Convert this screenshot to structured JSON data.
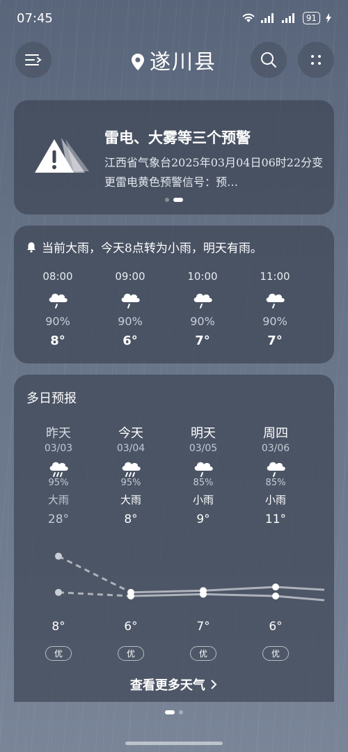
{
  "status_bar": {
    "time": "07:45",
    "battery": "91"
  },
  "header": {
    "city": "遂川县"
  },
  "alert": {
    "title": "雷电、大雾等三个预警",
    "text": "江西省气象台2025年03月04日06时22分变更雷电黄色预警信号：预…"
  },
  "hourly": {
    "summary": "当前大雨，今天8点转为小雨，明天有雨。",
    "items": [
      {
        "time": "08:00",
        "precip": "90%",
        "temp": "8°",
        "icon": "rain-cloud-icon"
      },
      {
        "time": "09:00",
        "precip": "90%",
        "temp": "6°",
        "icon": "rain-cloud-icon"
      },
      {
        "time": "10:00",
        "precip": "90%",
        "temp": "7°",
        "icon": "rain-cloud-icon"
      },
      {
        "time": "11:00",
        "precip": "90%",
        "temp": "7°",
        "icon": "rain-cloud-icon"
      }
    ]
  },
  "daily": {
    "title": "多日预报",
    "days": [
      {
        "name": "昨天",
        "date": "03/03",
        "precip": "95%",
        "weather": "大雨",
        "high": "28°",
        "low": "8°",
        "aqi": "优",
        "icon": "heavy-rain-icon"
      },
      {
        "name": "今天",
        "date": "03/04",
        "precip": "95%",
        "weather": "大雨",
        "high": "8°",
        "low": "6°",
        "aqi": "优",
        "icon": "heavy-rain-icon"
      },
      {
        "name": "明天",
        "date": "03/05",
        "precip": "85%",
        "weather": "小雨",
        "high": "9°",
        "low": "7°",
        "aqi": "优",
        "icon": "light-rain-icon"
      },
      {
        "name": "周四",
        "date": "03/06",
        "precip": "85%",
        "weather": "小雨",
        "high": "11°",
        "low": "6°",
        "aqi": "优",
        "icon": "light-rain-icon"
      }
    ],
    "more_label": "查看更多天气"
  },
  "chart_data": {
    "type": "line",
    "categories": [
      "03/03",
      "03/04",
      "03/05",
      "03/06"
    ],
    "series": [
      {
        "values": [
          28,
          8,
          9,
          11
        ]
      },
      {
        "values": [
          8,
          6,
          7,
          6
        ]
      }
    ]
  }
}
